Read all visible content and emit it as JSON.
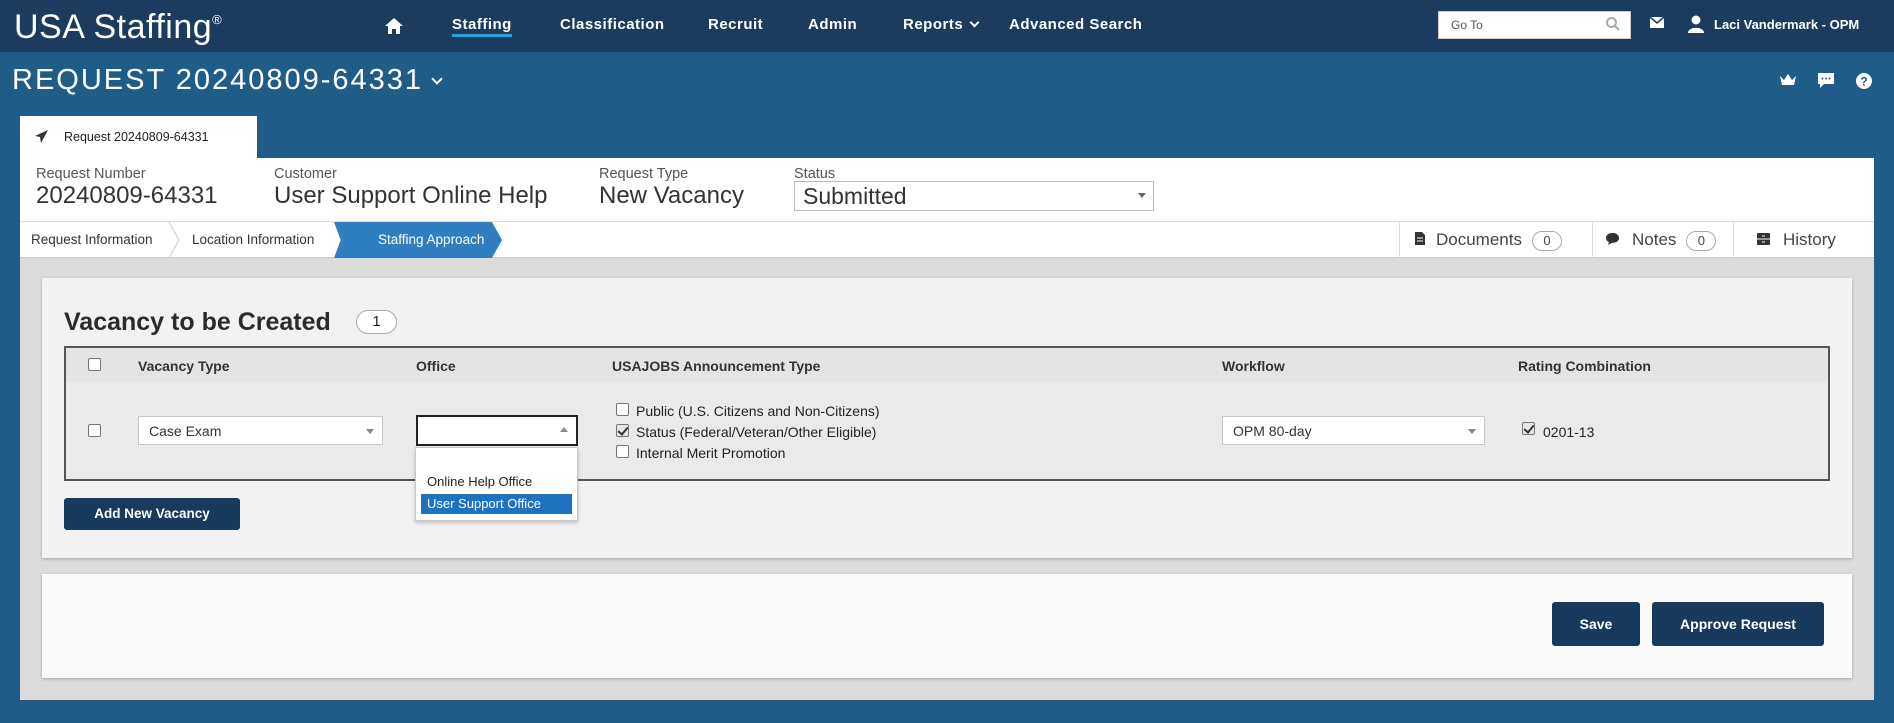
{
  "brand": {
    "name": "USA Staffing",
    "mark": "®"
  },
  "nav": {
    "items": [
      "Staffing",
      "Classification",
      "Recruit",
      "Admin",
      "Reports",
      "Advanced Search"
    ],
    "active": "Staffing",
    "goto_placeholder": "Go To",
    "user": "Laci Vandermark - OPM"
  },
  "page": {
    "title": "REQUEST 20240809-64331"
  },
  "tab": {
    "label": "Request 20240809-64331"
  },
  "info": {
    "request_number_label": "Request Number",
    "request_number": "20240809-64331",
    "customer_label": "Customer",
    "customer": "User Support Online Help",
    "request_type_label": "Request Type",
    "request_type": "New Vacancy",
    "status_label": "Status",
    "status": "Submitted"
  },
  "crumbs": {
    "step1": "Request Information",
    "step2": "Location Information",
    "step3": "Staffing Approach"
  },
  "side_tabs": {
    "documents": "Documents",
    "documents_count": "0",
    "notes": "Notes",
    "notes_count": "0",
    "history": "History"
  },
  "vacancy": {
    "title": "Vacancy to be Created",
    "count": "1",
    "headers": {
      "vacancy_type": "Vacancy Type",
      "office": "Office",
      "announcement": "USAJOBS Announcement Type",
      "workflow": "Workflow",
      "rating": "Rating Combination"
    },
    "row": {
      "vacancy_type": "Case Exam",
      "office": "",
      "announcement_options": [
        {
          "label": "Public (U.S. Citizens and Non-Citizens)",
          "checked": false
        },
        {
          "label": "Status (Federal/Veteran/Other Eligible)",
          "checked": true
        },
        {
          "label": "Internal Merit Promotion",
          "checked": false
        }
      ],
      "workflow": "OPM 80-day",
      "rating": "0201-13",
      "rating_checked": true
    },
    "office_options": [
      "Online Help Office",
      "User Support Office"
    ],
    "office_highlighted": "User Support Office",
    "add_button": "Add New Vacancy"
  },
  "actions": {
    "save": "Save",
    "approve": "Approve Request"
  },
  "colors": {
    "nav_bg": "#1b3c5e",
    "page_bg": "#205c88",
    "accent": "#2e7ec0",
    "button": "#173a5e"
  }
}
